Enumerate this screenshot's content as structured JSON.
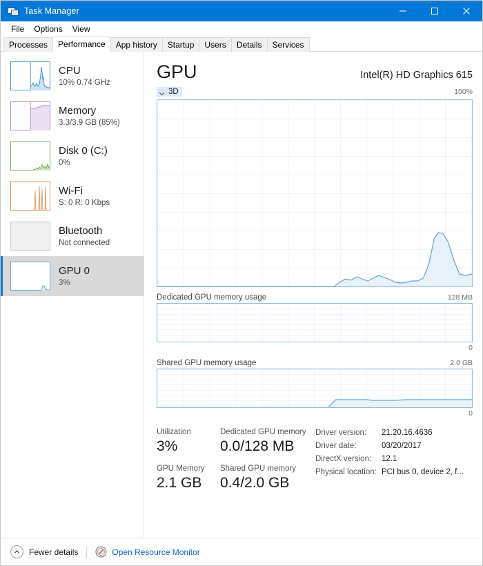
{
  "window": {
    "title": "Task Manager",
    "icon": "task-manager-icon",
    "controls": {
      "minimize": "─",
      "maximize": "□",
      "close": "✕"
    }
  },
  "menubar": {
    "items": [
      "File",
      "Options",
      "View"
    ]
  },
  "tabs": {
    "active": "Performance",
    "items": [
      "Processes",
      "Performance",
      "App history",
      "Startup",
      "Users",
      "Details",
      "Services"
    ]
  },
  "sidebar": {
    "items": [
      {
        "name": "CPU",
        "title": "CPU",
        "sub": "10%  0.74 GHz",
        "accent": "#4394d8",
        "selected": false
      },
      {
        "name": "Memory",
        "title": "Memory",
        "sub": "3.3/3.9 GB (85%)",
        "accent": "#b388cf",
        "selected": false
      },
      {
        "name": "Disk 0 (C:)",
        "title": "Disk 0 (C:)",
        "sub": "0%",
        "accent": "#77ad5a",
        "selected": false
      },
      {
        "name": "Wi-Fi",
        "title": "Wi-Fi",
        "sub": "S: 0 R: 0 Kbps",
        "accent": "#e08a48",
        "selected": false
      },
      {
        "name": "Bluetooth",
        "title": "Bluetooth",
        "sub": "Not connected",
        "accent": "#c9c9c9",
        "selected": false
      },
      {
        "name": "GPU 0",
        "title": "GPU 0",
        "sub": "3%",
        "accent": "#6ba6d6",
        "selected": true
      }
    ]
  },
  "main": {
    "title": "GPU",
    "device": "Intel(R) HD Graphics 615",
    "engine_label": "3D",
    "engine_max": "100%",
    "dedicated": {
      "label": "Dedicated GPU memory usage",
      "max": "128 MB",
      "min": "0"
    },
    "shared": {
      "label": "Shared GPU memory usage",
      "max": "2.0 GB",
      "min": "0"
    }
  },
  "stats": {
    "utilization_label": "Utilization",
    "utilization_value": "3%",
    "gpu_memory_label": "GPU Memory",
    "gpu_memory_value": "2.1 GB",
    "dedicated_label": "Dedicated GPU memory",
    "dedicated_value": "0.0/128 MB",
    "shared_label": "Shared GPU memory",
    "shared_value": "0.4/2.0 GB"
  },
  "info": [
    {
      "key": "Driver version:",
      "value": "21.20.16.4636"
    },
    {
      "key": "Driver date:",
      "value": "03/20/2017"
    },
    {
      "key": "DirectX version:",
      "value": "12.1"
    },
    {
      "key": "Physical location:",
      "value": "PCI bus 0, device 2, f..."
    }
  ],
  "statusbar": {
    "fewer_details": "Fewer details",
    "resource_monitor": "Open Resource Monitor"
  },
  "chart_data": [
    {
      "type": "area",
      "name": "3D engine utilization",
      "title": "3D",
      "ylabel": "%",
      "ylim": [
        0,
        100
      ],
      "grid": true,
      "x": [
        0,
        4,
        8,
        12,
        16,
        20,
        24,
        28,
        32,
        36,
        40,
        44,
        48,
        52,
        56,
        57,
        58,
        60,
        62,
        64,
        66,
        68,
        70,
        72,
        74,
        76,
        78,
        80,
        82,
        84,
        86,
        88,
        90,
        92,
        93,
        94,
        95,
        96,
        97,
        98,
        99,
        100
      ],
      "values": [
        0,
        0,
        0,
        0,
        0,
        0,
        0,
        0,
        0,
        0,
        0,
        0,
        0,
        0,
        0,
        1,
        2,
        3,
        4,
        3.5,
        4.5,
        3,
        2.5,
        3,
        4,
        3.5,
        3,
        2,
        1.5,
        1.5,
        1.5,
        2,
        12,
        26,
        30,
        30,
        28,
        20,
        12,
        6,
        4,
        4.5
      ]
    },
    {
      "type": "area",
      "name": "Dedicated GPU memory usage",
      "title": "Dedicated GPU memory usage",
      "ylim": [
        0,
        128
      ],
      "yunit": "MB",
      "grid": true,
      "x": [
        0,
        100
      ],
      "values": [
        0,
        0
      ]
    },
    {
      "type": "area",
      "name": "Shared GPU memory usage",
      "title": "Shared GPU memory usage",
      "ylim": [
        0,
        2.0
      ],
      "yunit": "GB",
      "grid": true,
      "x": [
        0,
        10,
        20,
        30,
        40,
        50,
        55,
        57,
        60,
        65,
        70,
        72,
        75,
        80,
        85,
        90,
        95,
        100
      ],
      "values": [
        0,
        0,
        0,
        0,
        0,
        0,
        0,
        0.38,
        0.4,
        0.4,
        0.38,
        0.37,
        0.38,
        0.38,
        0.38,
        0.4,
        0.4,
        0.4
      ]
    }
  ]
}
